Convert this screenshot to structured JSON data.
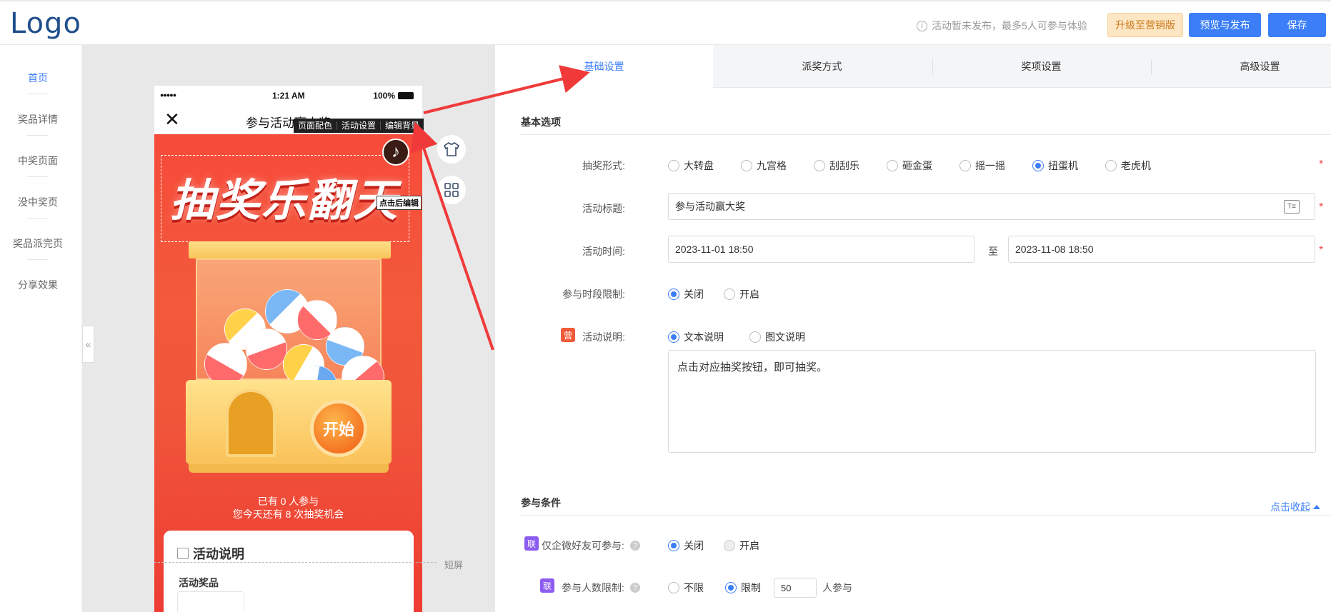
{
  "header": {
    "logo": "Logo",
    "notice": "活动暂未发布，最多5人可参与体验",
    "upgrade_label": "升级至营销版",
    "preview_label": "预览与发布",
    "save_label": "保存"
  },
  "leftnav": {
    "items": [
      {
        "label": "首页",
        "active": true
      },
      {
        "label": "奖品详情"
      },
      {
        "label": "中奖页面"
      },
      {
        "label": "没中奖页"
      },
      {
        "label": "奖品派完页"
      },
      {
        "label": "分享效果"
      }
    ],
    "collapse_glyph": "«"
  },
  "phone": {
    "signal": "●●●●●",
    "time": "1:21 AM",
    "battery": "100%",
    "close_glyph": "✕",
    "nav_title": "参与活动赢大奖",
    "big_title": "抽奖乐翻天",
    "start_label": "开始",
    "participants_line": "已有 0 人参与",
    "remaining_line": "您今天还有 8 次抽奖机会",
    "card_title": "活动说明",
    "card_sub": "活动奖品",
    "toolbar": [
      "页面配色",
      "活动设置",
      "编辑背景"
    ],
    "music_glyph": "♪",
    "edit_tip": "点击后编辑",
    "short_screen": "短屏"
  },
  "tabs": [
    {
      "label": "基础设置",
      "active": true
    },
    {
      "label": "派奖方式"
    },
    {
      "label": "奖项设置"
    },
    {
      "label": "高级设置"
    }
  ],
  "form": {
    "section_basic": "基本选项",
    "lottery_type_label": "抽奖形式:",
    "lottery_types": [
      "大转盘",
      "九宫格",
      "刮刮乐",
      "砸金蛋",
      "摇一摇",
      "扭蛋机",
      "老虎机"
    ],
    "lottery_type_selected": "扭蛋机",
    "title_label": "活动标题:",
    "title_value": "参与活动赢大奖",
    "time_label": "活动时间:",
    "time_start": "2023-11-01 18:50",
    "time_to": "至",
    "time_end": "2023-11-08 18:50",
    "period_label": "参与时段限制:",
    "off_label": "关闭",
    "on_label": "开启",
    "desc_badge": "营",
    "desc_label": "活动说明:",
    "desc_text_option": "文本说明",
    "desc_image_option": "图文说明",
    "desc_content": "点击对应抽奖按钮，即可抽奖。",
    "section_condition": "参与条件",
    "collapse_label": "点击收起",
    "wecom_badge": "联",
    "wecom_label": "仅企微好友可参与:",
    "limit_badge": "联",
    "limit_label": "参与人数限制:",
    "unlimited_label": "不限",
    "limited_label": "限制",
    "limit_value": "50",
    "limit_unit": "人参与",
    "help_glyph": "?",
    "required_glyph": "*",
    "textfmt_glyph": "T≡"
  },
  "colors": {
    "accent": "#3b7ef7",
    "annotation_arrow": "#f03a3a"
  }
}
